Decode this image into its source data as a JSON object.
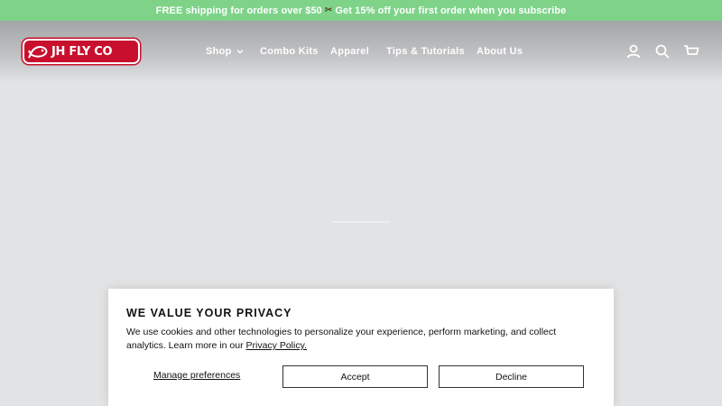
{
  "announcement": {
    "part1": "FREE shipping for orders over $50",
    "separator": "✂",
    "part2": "Get 15% off your first order when you subscribe"
  },
  "header": {
    "logo_text": "JH FLY CO",
    "nav": [
      {
        "label": "Shop",
        "icon": "chevron-down-icon"
      },
      {
        "label": "Combo Kits"
      },
      {
        "label": "Apparel"
      },
      {
        "label": "Tips & Tutorials"
      },
      {
        "label": "About Us"
      }
    ],
    "icons": [
      "account-icon",
      "search-icon",
      "cart-icon"
    ]
  },
  "colors": {
    "announcement_bg": "#7ed389",
    "brand_red": "#c8102e",
    "page_bg": "#e2e3e4"
  },
  "cookie_banner": {
    "title": "WE VALUE YOUR PRIVACY",
    "body": "We use cookies and other technologies to personalize your experience, perform marketing, and collect analytics. Learn more in our ",
    "link": "Privacy Policy.",
    "manage_label": "Manage preferences",
    "accept_label": "Accept",
    "decline_label": "Decline"
  }
}
